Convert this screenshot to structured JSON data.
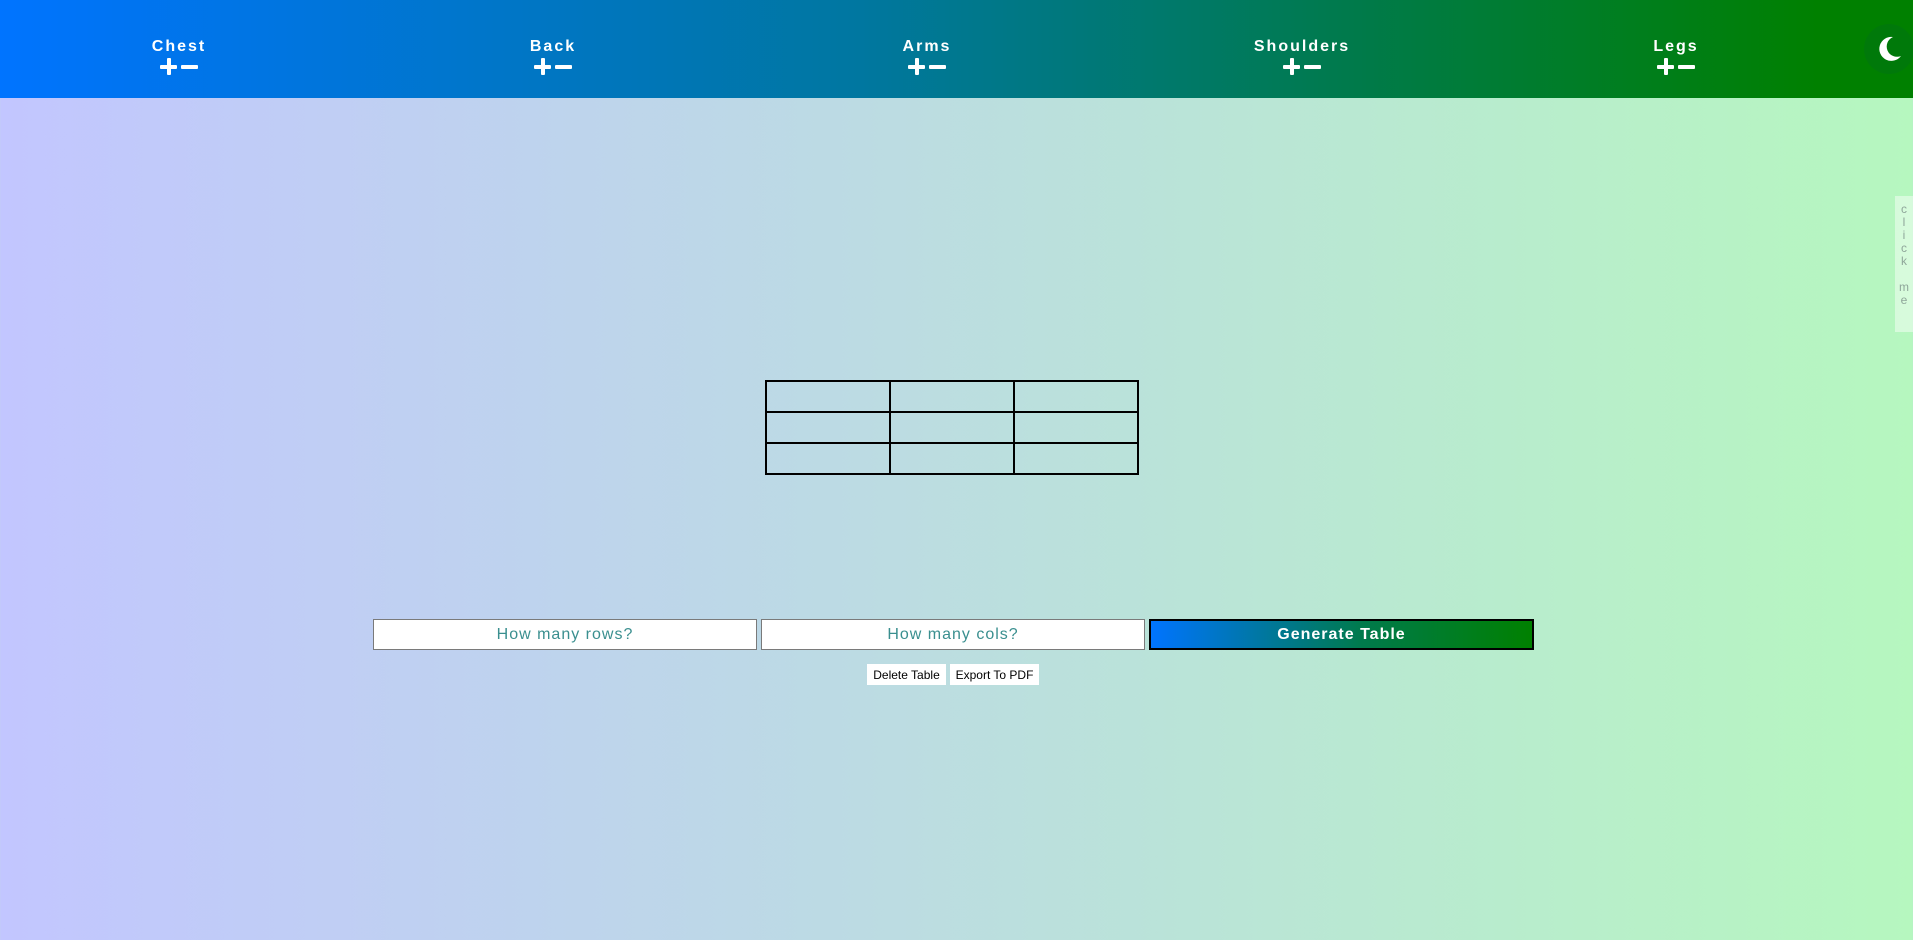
{
  "nav": {
    "items": [
      {
        "label": "Chest"
      },
      {
        "label": "Back"
      },
      {
        "label": "Arms"
      },
      {
        "label": "Shoulders"
      },
      {
        "label": "Legs"
      }
    ],
    "theme_icon": "moon-icon"
  },
  "side_tab": {
    "letters": [
      "c",
      "l",
      "i",
      "c",
      "k",
      "",
      "m",
      "e"
    ]
  },
  "table": {
    "rows": 3,
    "cols": 3
  },
  "form": {
    "rows_placeholder": "How many rows?",
    "cols_placeholder": "How many cols?",
    "generate_label": "Generate Table",
    "delete_label": "Delete Table",
    "export_label": "Export To PDF"
  },
  "colors": {
    "nav_start": "#0074ff",
    "nav_end": "#008000",
    "bg_start": "#c2c6ff",
    "bg_end": "#b6f7bf",
    "placeholder": "#3a8f8f"
  }
}
